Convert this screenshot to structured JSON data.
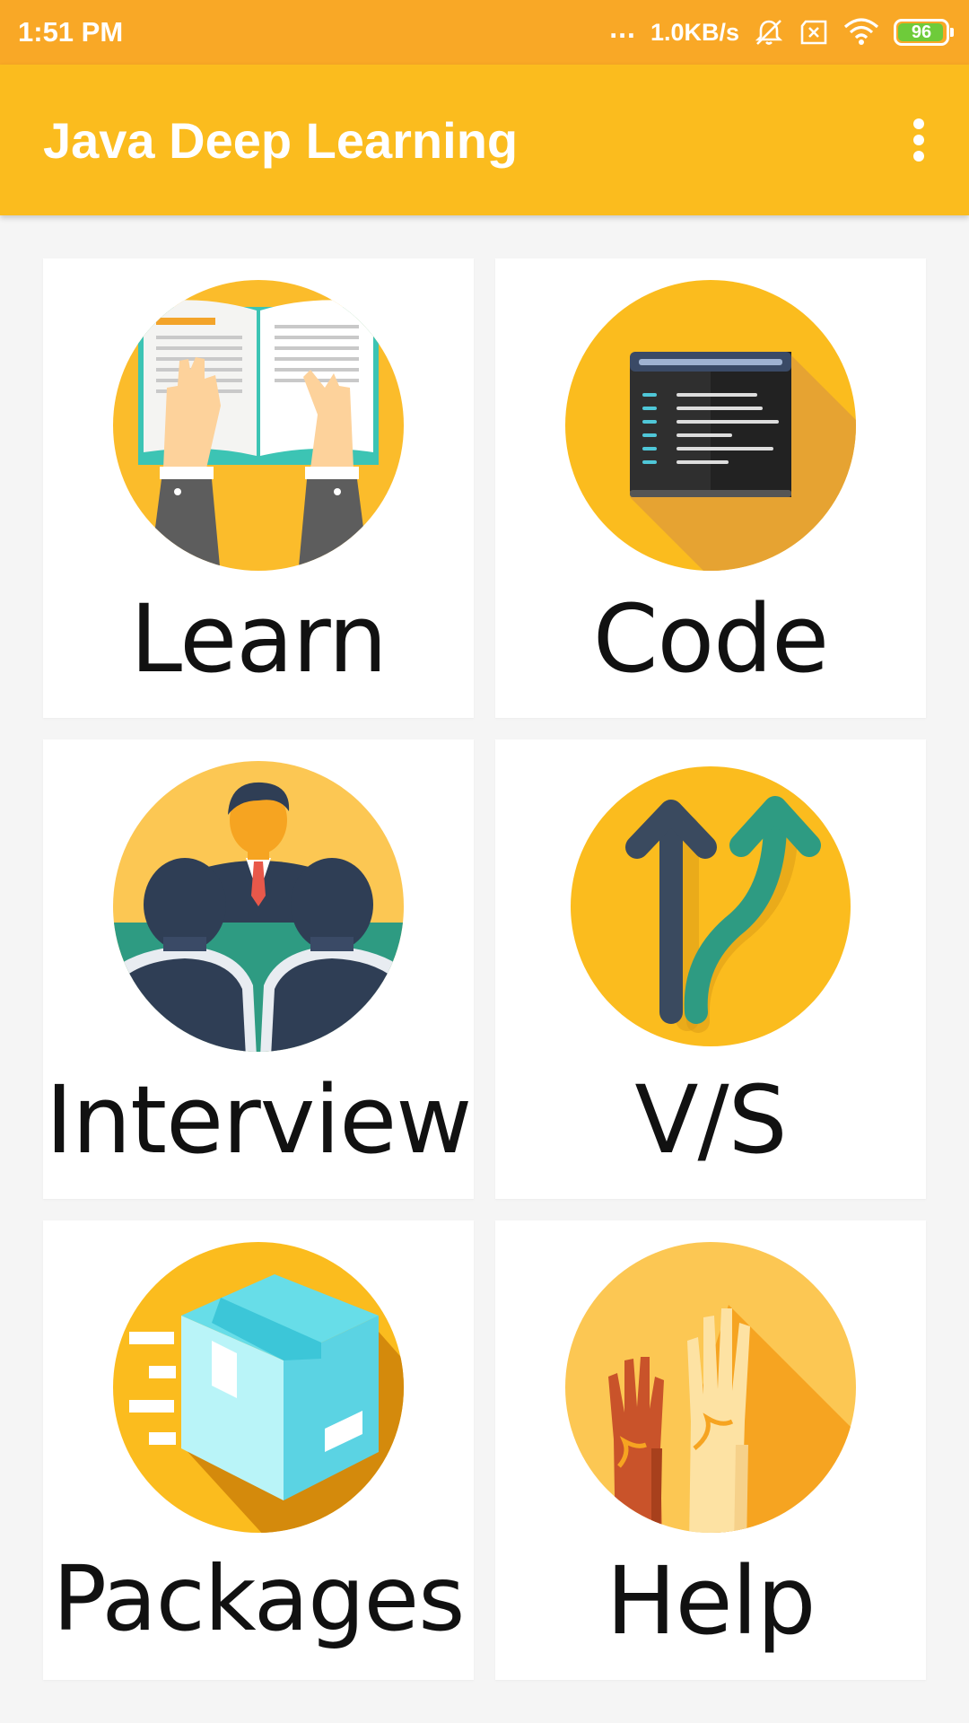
{
  "status_bar": {
    "time": "1:51 PM",
    "dots": "...",
    "network_speed": "1.0KB/s",
    "battery_level": "96",
    "icons": [
      "dnd-bell-off-icon",
      "sim-x-icon",
      "wifi-icon",
      "battery-icon"
    ]
  },
  "app_bar": {
    "title": "Java Deep Learning",
    "menu_icon": "more-vert-icon"
  },
  "colors": {
    "status_bar": "#f9a826",
    "app_bar": "#fbbc1e",
    "background": "#f5f5f5",
    "card": "#ffffff"
  },
  "cards": [
    {
      "label": "Learn",
      "icon": "open-book-hands-icon"
    },
    {
      "label": "Code",
      "icon": "code-window-icon"
    },
    {
      "label": "Interview",
      "icon": "interview-panel-icon"
    },
    {
      "label": "V/S",
      "icon": "diverging-arrows-icon"
    },
    {
      "label": "Packages",
      "icon": "package-box-icon"
    },
    {
      "label": "Help",
      "icon": "raised-hands-icon"
    }
  ]
}
